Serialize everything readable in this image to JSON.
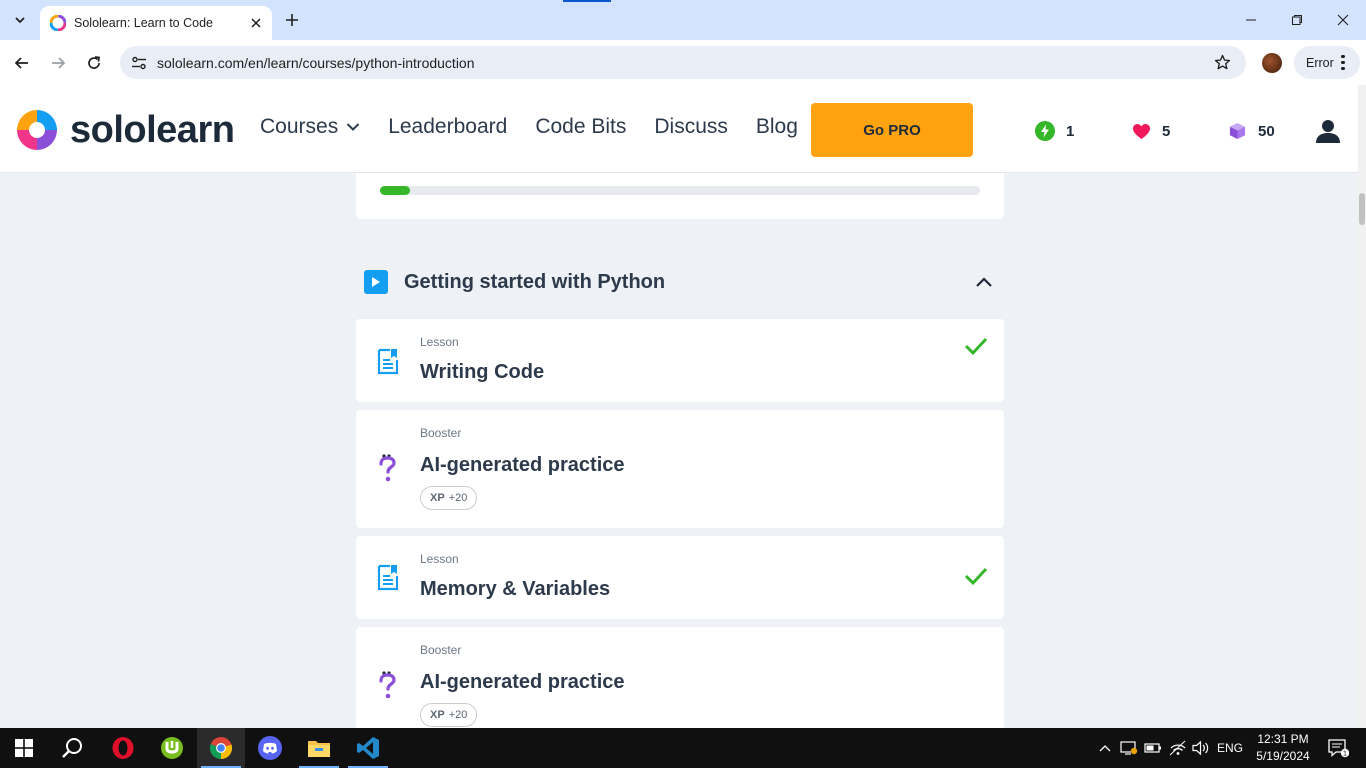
{
  "browser": {
    "tab_title": "Sololearn: Learn to Code",
    "url": "sololearn.com/en/learn/courses/python-introduction",
    "profile_chip_label": "Error"
  },
  "header": {
    "logo_text": "sololearn",
    "nav": {
      "courses": "Courses",
      "leaderboard": "Leaderboard",
      "code_bits": "Code Bits",
      "discuss": "Discuss",
      "blog": "Blog"
    },
    "go_pro": "Go PRO",
    "streak_count": "1",
    "hearts_count": "5",
    "bits_count": "50"
  },
  "course_progress": {
    "fraction": 0.05,
    "color": "#35b729"
  },
  "module": {
    "title": "Getting started with Python",
    "items": [
      {
        "type": "Lesson",
        "title": "Writing Code",
        "completed": true,
        "icon": "lesson-icon"
      },
      {
        "type": "Booster",
        "title": "AI-generated practice",
        "xp_label": "XP",
        "xp_value": "+20",
        "icon": "booster-question-icon"
      },
      {
        "type": "Lesson",
        "title": "Memory & Variables",
        "completed": true,
        "icon": "lesson-icon"
      },
      {
        "type": "Booster",
        "title": "AI-generated practice",
        "xp_label": "XP",
        "xp_value": "+20",
        "icon": "booster-question-icon"
      }
    ]
  },
  "taskbar": {
    "language": "ENG",
    "time": "12:31 PM",
    "date": "5/19/2024",
    "notification_count": "1"
  },
  "colors": {
    "accent_orange": "#ffa310",
    "lesson_blue": "#149ef2",
    "booster_purple": "#8b4fd8",
    "check_green": "#35b729"
  }
}
